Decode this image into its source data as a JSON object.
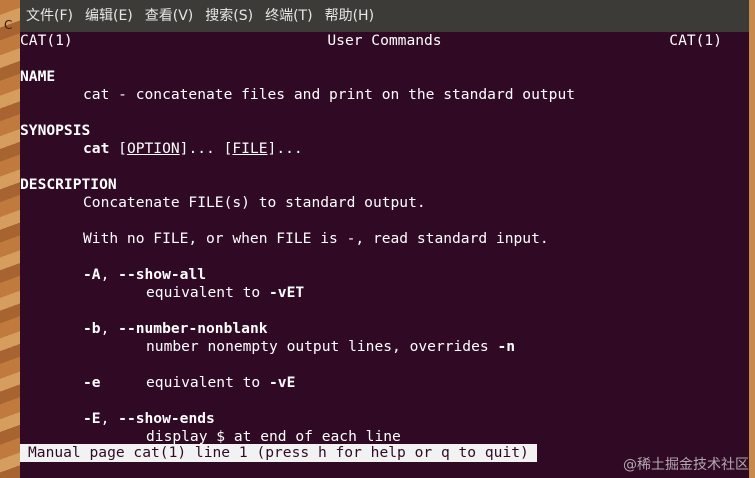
{
  "menubar": {
    "items": [
      "文件(F)",
      "编辑(E)",
      "查看(V)",
      "搜索(S)",
      "终端(T)",
      "帮助(H)"
    ]
  },
  "left_glyph": "C",
  "man": {
    "header_left": "CAT(1)",
    "header_center": "User Commands",
    "header_right": "CAT(1)",
    "name_heading": "NAME",
    "name_line": "cat - concatenate files and print on the standard output",
    "synopsis_heading": "SYNOPSIS",
    "synopsis_cmd": "cat",
    "synopsis_open1": " [",
    "synopsis_option": "OPTION",
    "synopsis_close1": "]... [",
    "synopsis_file": "FILE",
    "synopsis_close2": "]...",
    "description_heading": "DESCRIPTION",
    "desc_line1": "Concatenate FILE(s) to standard output.",
    "desc_line2": "With no FILE, or when FILE is -, read standard input.",
    "opt_a_flag": "-A",
    "opt_a_sep": ", ",
    "opt_a_long": "--show-all",
    "opt_a_desc_text": "equivalent to ",
    "opt_a_desc_flag": "-vET",
    "opt_b_flag": "-b",
    "opt_b_sep": ", ",
    "opt_b_long": "--number-nonblank",
    "opt_b_desc_text": "number nonempty output lines, overrides ",
    "opt_b_desc_flag": "-n",
    "opt_e_flag": "-e",
    "opt_e_desc_text": "equivalent to ",
    "opt_e_desc_flag": "-vE",
    "opt_E_flag": "-E",
    "opt_E_sep": ", ",
    "opt_E_long": "--show-ends",
    "opt_E_desc": "display $ at end of each line"
  },
  "status_bar": "Manual page cat(1) line 1 (press h for help or q to quit)",
  "watermark": "@稀土掘金技术社区",
  "colors": {
    "terminal_bg": "#300a24",
    "menubar_bg": "#3c3b37",
    "status_bg": "#f2f2f2"
  }
}
